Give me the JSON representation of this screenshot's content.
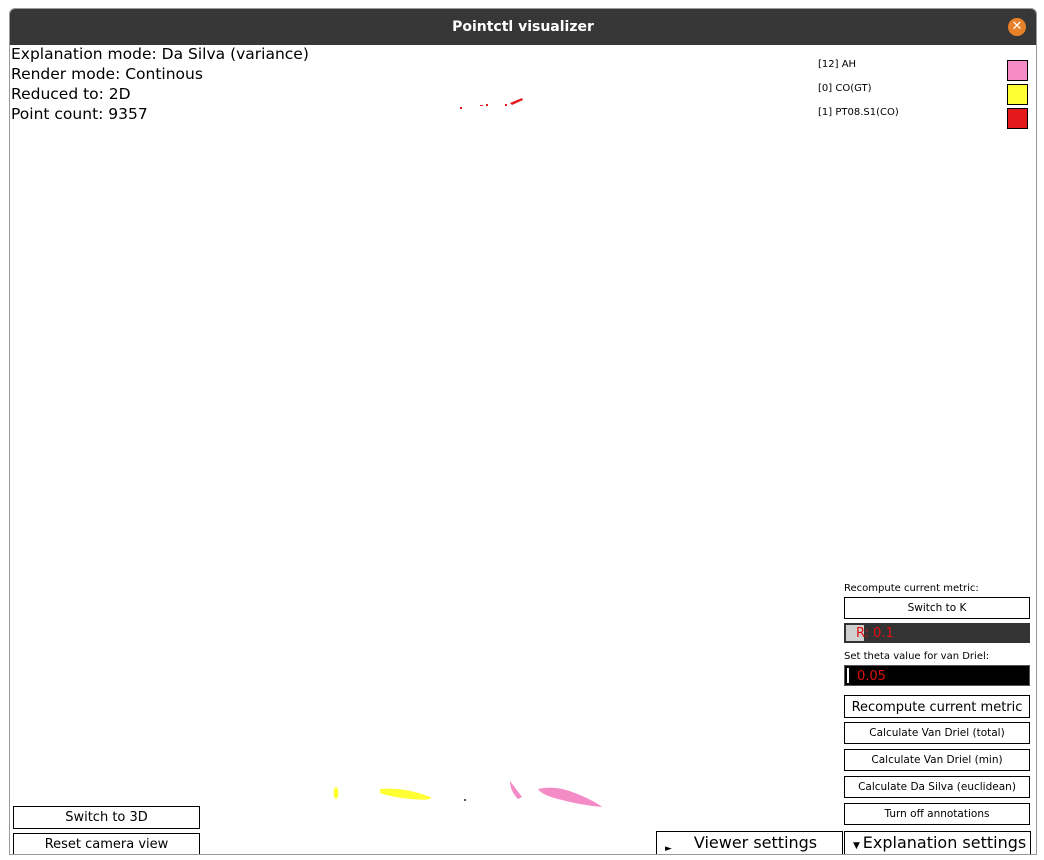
{
  "window": {
    "title": "Pointctl visualizer"
  },
  "info": {
    "explanation_mode": "Explanation mode: Da Silva (variance)",
    "render_mode": "Render mode: Continous",
    "reduced_to": "Reduced to: 2D",
    "point_count": "Point count: 9357"
  },
  "legend": [
    {
      "label": "[12] AH",
      "color": "#f48bc6"
    },
    {
      "label": "[0] CO(GT)",
      "color": "#ffff33"
    },
    {
      "label": "[1] PT08.S1(CO)",
      "color": "#e31a1c"
    }
  ],
  "controls": {
    "recompute_header": "Recompute current metric:",
    "switch_to_k": "Switch to K",
    "r_slider": {
      "text": "R: 0.1",
      "value": 0.1
    },
    "theta_label": "Set theta value for van Driel:",
    "theta_value": "0.05",
    "recompute_button": "Recompute current metric",
    "calc_van_driel_total": "Calculate Van Driel (total)",
    "calc_van_driel_min": "Calculate Van Driel (min)",
    "calc_da_silva": "Calculate Da Silva (euclidean)",
    "turn_off_annotations": "Turn off annotations"
  },
  "bottom": {
    "switch_to_3d": "Switch to 3D",
    "reset_camera": "Reset camera view",
    "viewer_settings": "Viewer settings",
    "explanation_settings": "Explanation settings"
  },
  "icons": {
    "close": "close-icon",
    "viewer_collapsed": "triangle-right-icon",
    "explanation_expanded": "triangle-down-icon"
  }
}
